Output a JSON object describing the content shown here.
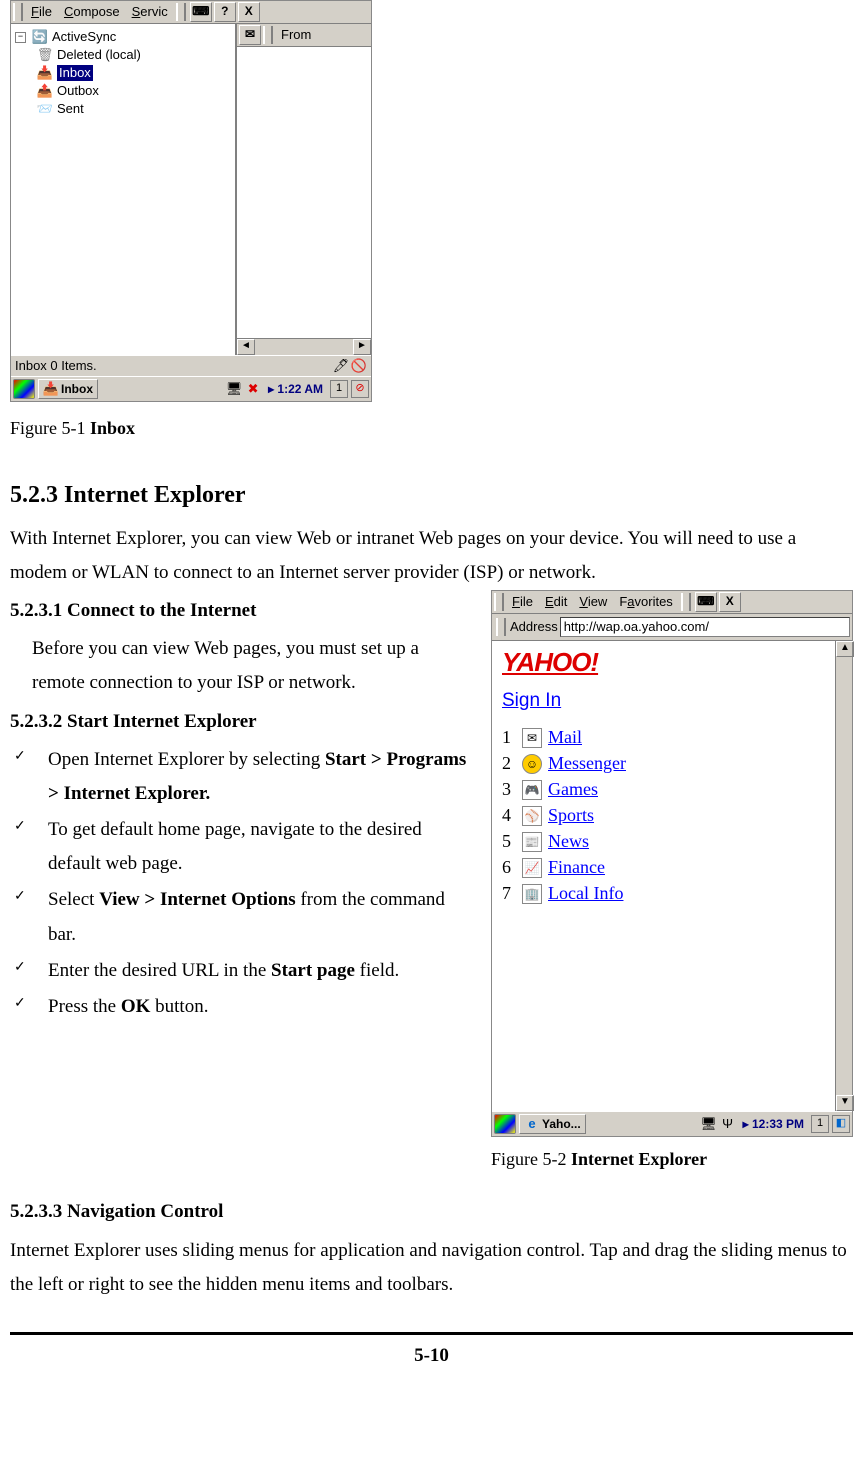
{
  "inbox_shot": {
    "menu": {
      "file": "File",
      "compose": "Compose",
      "service": "Servic",
      "help": "?",
      "close": "X"
    },
    "tree": {
      "root": "ActiveSync",
      "items": [
        {
          "label": "Deleted (local)"
        },
        {
          "label": "Inbox",
          "selected": true
        },
        {
          "label": "Outbox"
        },
        {
          "label": "Sent"
        }
      ]
    },
    "right_header": "From",
    "status": "Inbox 0 Items.",
    "taskbar": {
      "app": "Inbox",
      "time": "1:22 AM"
    }
  },
  "fig1": {
    "prefix": "Figure 5-1 ",
    "bold": "Inbox"
  },
  "sec_title": "5.2.3 Internet Explorer",
  "sec_intro": "With Internet Explorer, you can view Web or intranet Web pages on your device. You will need to use a modem or WLAN to connect to an Internet server provider (ISP) or network.",
  "sub1_title": "5.2.3.1 Connect to the Internet",
  "sub1_text": "Before you can view Web pages, you must set up a remote connection to your ISP or network.",
  "sub2_title": "5.2.3.2 Start Internet Explorer",
  "bullets": {
    "0": {
      "pre": "Open Internet Explorer by selecting ",
      "b": "Start > Programs > Internet Explorer."
    },
    "1": {
      "pre": "To get default home page, navigate to the desired default web page."
    },
    "2": {
      "pre": "Select ",
      "b": "View > Internet Options",
      "post": " from the command bar."
    },
    "3": {
      "pre": "Enter the desired URL in the ",
      "b": "Start page",
      "post": " field."
    },
    "4": {
      "pre": "Press the ",
      "b": "OK",
      "post": " button."
    }
  },
  "ie_shot": {
    "menu": {
      "file": "File",
      "edit": "Edit",
      "view": "View",
      "fav": "Favorites"
    },
    "close": "X",
    "addr_label": "Address",
    "addr_value": "http://wap.oa.yahoo.com/",
    "logo": "YAHOO!",
    "signin": "Sign In",
    "items": [
      {
        "n": "1",
        "label": "Mail"
      },
      {
        "n": "2",
        "label": "Messenger"
      },
      {
        "n": "3",
        "label": "Games"
      },
      {
        "n": "4",
        "label": "Sports"
      },
      {
        "n": "5",
        "label": "News"
      },
      {
        "n": "6",
        "label": "Finance"
      },
      {
        "n": "7",
        "label": "Local Info"
      }
    ],
    "taskbar": {
      "app": "Yaho...",
      "time": "12:33 PM"
    }
  },
  "fig2": {
    "prefix": "Figure 5-2 ",
    "bold": "Internet Explorer"
  },
  "sub3_title": "5.2.3.3 Navigation Control",
  "sub3_text": "Internet Explorer uses sliding menus for application and navigation control. Tap and drag the sliding menus to the left or right to see the hidden menu items and toolbars.",
  "page_num": "5-10"
}
